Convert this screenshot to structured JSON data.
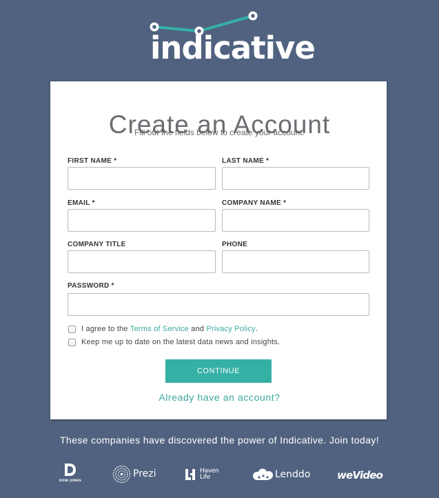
{
  "brand": {
    "name": "indicative",
    "accent": "#35b0a5",
    "background": "#50627f",
    "logo_icon": "line-chart-logo-icon"
  },
  "header": {
    "title": "Create an Account",
    "subtitle": "Fill out the fields below to create your account."
  },
  "form": {
    "first_name": {
      "label": "FIRST NAME *",
      "value": "",
      "placeholder": ""
    },
    "last_name": {
      "label": "LAST NAME *",
      "value": "",
      "placeholder": ""
    },
    "email": {
      "label": "EMAIL *",
      "value": "",
      "placeholder": ""
    },
    "company_name": {
      "label": "COMPANY NAME *",
      "value": "",
      "placeholder": ""
    },
    "company_title": {
      "label": "COMPANY TITLE",
      "value": "",
      "placeholder": ""
    },
    "phone": {
      "label": "PHONE",
      "value": "",
      "placeholder": ""
    },
    "password": {
      "label": "PASSWORD *",
      "value": "",
      "placeholder": ""
    }
  },
  "agreements": {
    "terms_prefix": "I agree to the",
    "terms_link": "Terms of Service",
    "terms_and": "and",
    "privacy_link": "Privacy Policy",
    "terms_suffix": ".",
    "terms_checked": false,
    "newsletter_label": "Keep me up to date on the latest data news and insights.",
    "newsletter_checked": false
  },
  "actions": {
    "continue_label": "CONTINUE",
    "login_link": "Already have an account?"
  },
  "footer": {
    "tagline": "These companies have discovered the power of Indicative. Join today!",
    "clients": [
      {
        "name": "DOW JONES",
        "icon": "dow-jones-logo-icon"
      },
      {
        "name": "Prezi",
        "icon": "prezi-logo-icon"
      },
      {
        "name": "Haven Life",
        "icon": "haven-life-logo-icon"
      },
      {
        "name": "Lenddo",
        "icon": "lenddo-logo-icon"
      },
      {
        "name": "weVideo",
        "icon": "wevideo-logo-icon"
      }
    ]
  }
}
